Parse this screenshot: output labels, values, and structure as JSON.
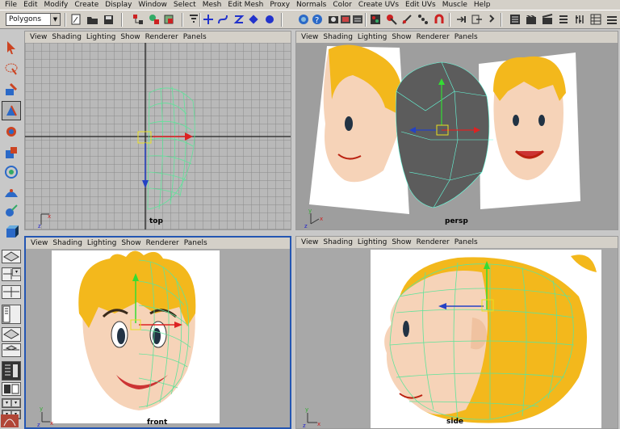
{
  "menu": [
    "File",
    "Edit",
    "Modify",
    "Create",
    "Display",
    "Window",
    "Select",
    "Mesh",
    "Edit Mesh",
    "Proxy",
    "Normals",
    "Color",
    "Create UVs",
    "Edit UVs",
    "Muscle",
    "Help"
  ],
  "shelf": {
    "mode_value": "Polygons"
  },
  "panel_menu": [
    "View",
    "Shading",
    "Lighting",
    "Show",
    "Renderer",
    "Panels"
  ],
  "viewports": {
    "top": {
      "label": "top"
    },
    "persp": {
      "label": "persp"
    },
    "front": {
      "label": "front"
    },
    "side": {
      "label": "side"
    }
  },
  "colors": {
    "active_border": "#2456b2",
    "wire": "#5fe39a",
    "hair": "#f3b81c",
    "skin": "#f6d3b8"
  }
}
